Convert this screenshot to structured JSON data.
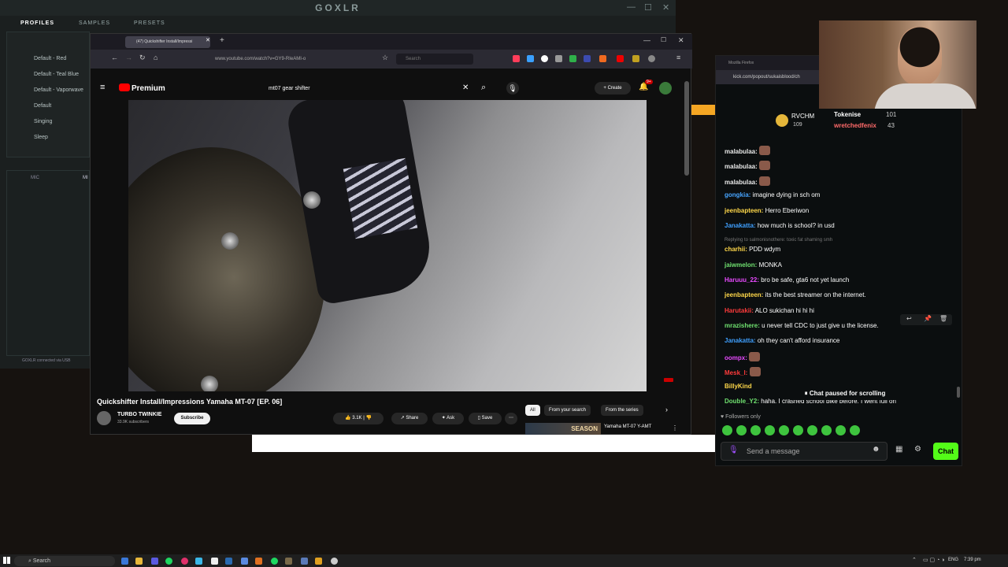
{
  "goxlr": {
    "title": "GOXLR",
    "tabs": [
      "PROFILES",
      "SAMPLES",
      "PRESETS"
    ],
    "profiles": [
      "Default - Red",
      "Default - Teal Blue",
      "Default - Vaporwave",
      "Default",
      "Singing",
      "Sleep"
    ],
    "mic_tabs": [
      "MIC",
      "MI"
    ],
    "status": "GOXLR connected via USB"
  },
  "firefox": {
    "tab_title": "(47) Quickshifter Install/Impressi",
    "url": "www.youtube.com/watch?v=GY9-RIeAMI-o",
    "search_placeholder": "Search"
  },
  "youtube": {
    "logo": "Premium",
    "search_query": "mt07 gear shifter",
    "create_label": "+ Create",
    "notif_count": "9+",
    "video_title": "Quickshifter Install/Impressions Yamaha MT-07 [EP. 06]",
    "channel_name": "TURBO TWINKIE",
    "channel_subs": "33.9K subscribers",
    "subscribe_label": "Subscribe",
    "likes": "3.1K",
    "share_label": "Share",
    "ask_label": "Ask",
    "save_label": "Save",
    "chips": [
      "All",
      "From your search",
      "From the series"
    ],
    "rec_thumb_text": "SEASON",
    "rec_title": "Yamaha MT-07 Y-AMT"
  },
  "kick": {
    "window_title": "Mozilla Firefox",
    "url": "kick.com/popout/sukaisblood/ch",
    "leaderboard": [
      {
        "name": "RVCHM",
        "count": "109"
      },
      {
        "name": "Tokenise",
        "count": "101"
      },
      {
        "name": "wretchedfenix",
        "count": "43"
      }
    ],
    "messages": [
      {
        "user": "malabulaa:",
        "text": "",
        "color": "#e8e8e8",
        "emote": true
      },
      {
        "user": "malabulaa:",
        "text": "",
        "color": "#e8e8e8",
        "emote": true
      },
      {
        "user": "malabulaa:",
        "text": "",
        "color": "#e8e8e8",
        "emote": true
      },
      {
        "user": "gongkia:",
        "text": "imagine dying in sch om",
        "color": "#47a5ff"
      },
      {
        "user": "jeenbapteen:",
        "text": "Herro Eberiwon",
        "color": "#ffd84a"
      },
      {
        "user": "Janakatta:",
        "text": "how much is school? in usd",
        "color": "#3fa0ff"
      },
      {
        "user": "",
        "text": "Replying to salmonisnothere: toxic fat shaming smh",
        "color": "#777"
      },
      {
        "user": "charhii:",
        "text": "PDD wdym",
        "color": "#ffd84a"
      },
      {
        "user": "jaiwmelon:",
        "text": "MONKA",
        "color": "#6fe06f"
      },
      {
        "user": "Haruuu_22:",
        "text": "bro be safe, gta6 not yet launch",
        "color": "#e84aff"
      },
      {
        "user": "jeenbapteen:",
        "text": "its the best streamer on the internet.",
        "color": "#ffd84a"
      },
      {
        "user": "Harutakii:",
        "text": "ALO sukichan hi hi hi",
        "color": "#ff3b3b"
      },
      {
        "user": "mrazishere:",
        "text": "u never tell CDC to just give u the license.",
        "color": "#6fe06f"
      },
      {
        "user": "Janakatta:",
        "text": "oh they can't afford insurance",
        "color": "#3fa0ff"
      },
      {
        "user": "oompx:",
        "text": "",
        "color": "#e84aff",
        "emote": true
      },
      {
        "user": "Mesk_l:",
        "text": "",
        "color": "#ff3b3b",
        "emote": true
      },
      {
        "user": "BillyKind",
        "text": "",
        "color": "#ffd84a"
      },
      {
        "user": "Double_Y2:",
        "text": "haha. I crashed school bike before. I went full on",
        "color": "#6fe06f"
      }
    ],
    "paused_label": "Chat paused for scrolling",
    "followers_only": "Followers only",
    "message_placeholder": "Send a message",
    "chat_button": "Chat"
  },
  "taskbar": {
    "search_label": "Search",
    "language": "ENG",
    "time": "7:39 pm"
  }
}
